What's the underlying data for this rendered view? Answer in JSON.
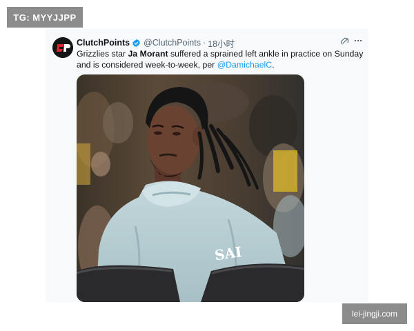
{
  "watermarks": {
    "top_left": "TG: MYYJJPP",
    "bottom_right": "lei-jingji.com"
  },
  "tweet": {
    "author": {
      "display_name": "ClutchPoints",
      "handle": "@ClutchPoints",
      "verified": true,
      "avatar_text": "CP",
      "avatar_color": "#d7282f"
    },
    "separator": "·",
    "timestamp": "18小时",
    "text": {
      "part1": "Grizzlies star ",
      "bold": "Ja Morant",
      "part2": " suffered a sprained left ankle in practice on Sunday and is considered week-to-week, per ",
      "mention": "@DamichaelC",
      "end": "."
    },
    "icons": [
      "verified-badge-icon",
      "grok-icon",
      "more-icon"
    ],
    "media": {
      "type": "photo",
      "colors": {
        "hoodie": "#b7cfd4",
        "skin": "#6a4232",
        "hair": "#151515",
        "seat": "#2a2a2c"
      }
    }
  },
  "colors": {
    "accent": "#1d9bf0",
    "text": "#0f1419",
    "secondary": "#536471",
    "watermark_bg": "#8c8c8c"
  }
}
